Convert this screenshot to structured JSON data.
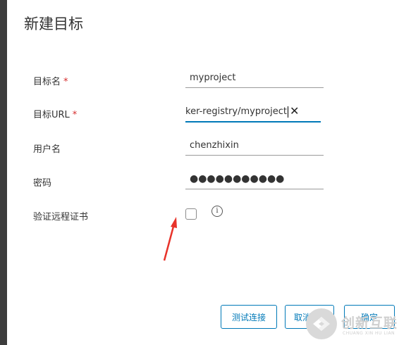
{
  "dialog": {
    "title": "新建目标",
    "fields": [
      {
        "label": "目标名",
        "required": true,
        "value": "myproject"
      },
      {
        "label": "目标URL",
        "required": true,
        "value": "ker-registry/myproject"
      },
      {
        "label": "用户名",
        "required": false,
        "value": "chenzhixin"
      },
      {
        "label": "密码",
        "required": false,
        "value": "●●●●●●●●●●●"
      },
      {
        "label": "验证远程证书",
        "required": false,
        "checked": false
      }
    ],
    "required_mark": "*",
    "clear_icon_glyph": "✕",
    "info_icon_glyph": "i",
    "buttons": {
      "test": "测试连接",
      "cancel": "取消",
      "ok": "确定"
    }
  },
  "watermark": {
    "text": "创新互联",
    "sub": "CHUANG XIN HU LIAN"
  },
  "colors": {
    "accent": "#0079b8",
    "required": "#d62d2d",
    "annotation_arrow": "#e8332a"
  },
  "icons": [
    "clear-icon",
    "info-icon",
    "annotation-arrow"
  ]
}
